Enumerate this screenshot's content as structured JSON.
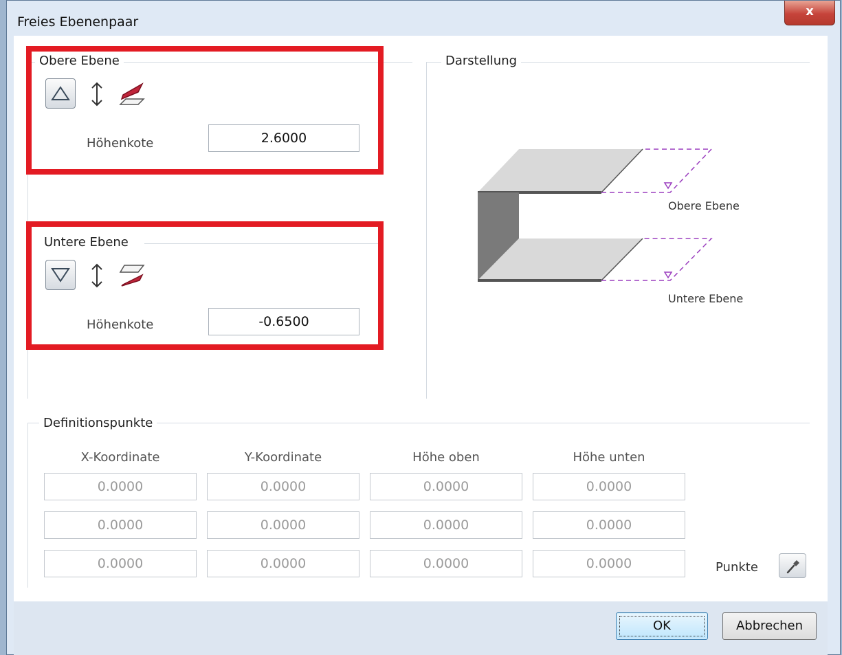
{
  "window": {
    "title": "Freies Ebenenpaar",
    "close_glyph": "x"
  },
  "upper": {
    "group_label": "Obere Ebene",
    "height_label": "Höhenkote",
    "height_value": "2.6000",
    "icons": [
      "plane-up-icon",
      "vertical-arrows-icon",
      "slanted-plane-icon"
    ]
  },
  "lower": {
    "group_label": "Untere Ebene",
    "height_label": "Höhenkote",
    "height_value": "-0.6500",
    "icons": [
      "plane-down-icon",
      "vertical-arrows-icon",
      "slanted-plane-icon"
    ]
  },
  "preview": {
    "group_label": "Darstellung",
    "upper_label": "Obere Ebene",
    "lower_label": "Untere Ebene",
    "colors": {
      "surface": "#d9d9d9",
      "edge": "#555555",
      "dashed": "#9b3fbf"
    }
  },
  "points": {
    "group_label": "Definitionspunkte",
    "columns": [
      "X-Koordinate",
      "Y-Koordinate",
      "Höhe oben",
      "Höhe unten"
    ],
    "rows": [
      [
        "0.0000",
        "0.0000",
        "0.0000",
        "0.0000"
      ],
      [
        "0.0000",
        "0.0000",
        "0.0000",
        "0.0000"
      ],
      [
        "0.0000",
        "0.0000",
        "0.0000",
        "0.0000"
      ]
    ],
    "pick_label": "Punkte",
    "pick_icon": "pipette-icon"
  },
  "buttons": {
    "ok": "OK",
    "cancel": "Abbrechen"
  },
  "colors": {
    "highlight": "#e31b23",
    "icon_red": "#c0253a"
  }
}
